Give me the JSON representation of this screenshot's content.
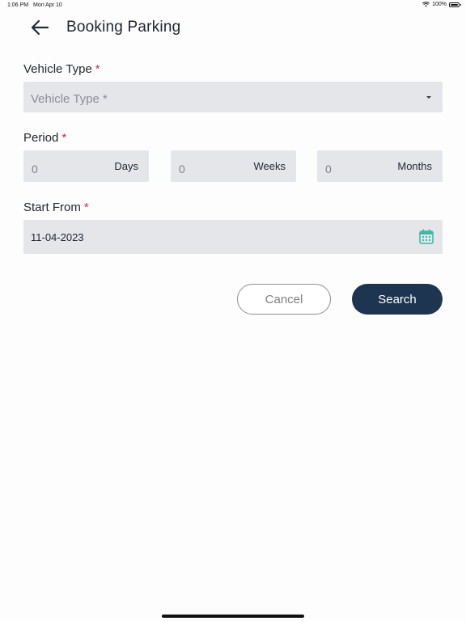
{
  "status_bar": {
    "time": "1:06 PM",
    "date": "Mon Apr 10",
    "battery": "100%"
  },
  "header": {
    "title": "Booking Parking",
    "back_icon": "arrow-left-icon"
  },
  "form": {
    "vehicle_type": {
      "label": "Vehicle Type",
      "required_mark": "*",
      "placeholder": "Vehicle Type *"
    },
    "period": {
      "label": "Period",
      "required_mark": "*",
      "fields": [
        {
          "value": "0",
          "unit": "Days"
        },
        {
          "value": "0",
          "unit": "Weeks"
        },
        {
          "value": "0",
          "unit": "Months"
        }
      ]
    },
    "start_from": {
      "label": "Start From",
      "required_mark": "*",
      "value": "11-04-2023",
      "icon": "calendar-icon"
    }
  },
  "actions": {
    "cancel_label": "Cancel",
    "search_label": "Search"
  },
  "colors": {
    "primary": "#1e3552",
    "required": "#e0273a",
    "field_bg": "#e4e6ea",
    "calendar_icon": "#3fb8a6"
  }
}
